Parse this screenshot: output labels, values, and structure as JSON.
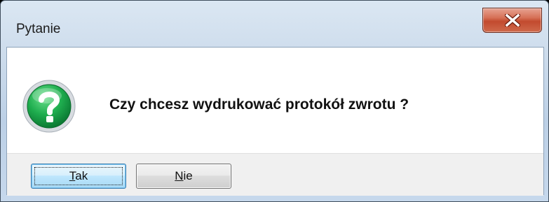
{
  "window": {
    "title": "Pytanie",
    "close_icon": "close-x-icon"
  },
  "dialog": {
    "icon": "question-icon",
    "icon_color": "#17a34a",
    "message": "Czy chcesz wydrukować protokół zwrotu ?"
  },
  "buttons": {
    "yes": {
      "mnemonic": "T",
      "rest": "ak"
    },
    "no": {
      "mnemonic": "N",
      "rest": "ie"
    }
  },
  "colors": {
    "close_button": "#c94b2f",
    "default_button_border": "#3c7fb1"
  }
}
